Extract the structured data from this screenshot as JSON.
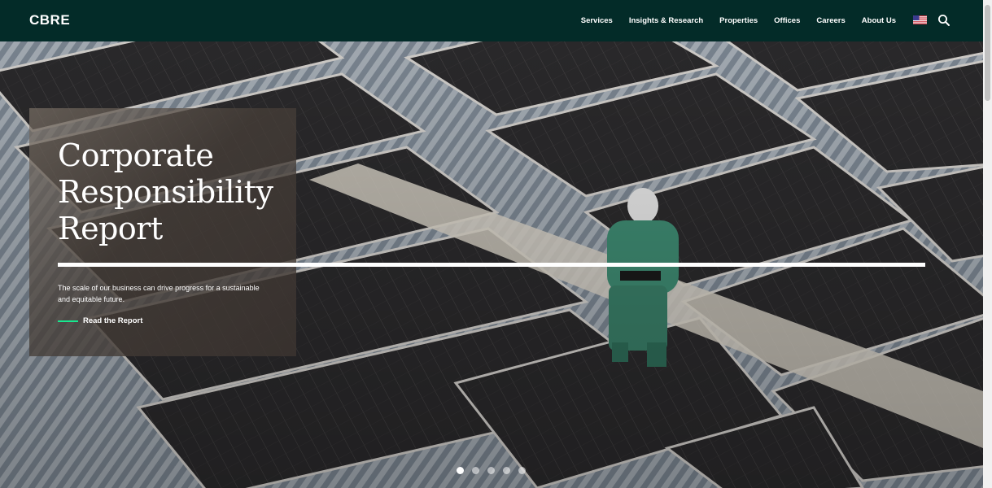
{
  "header": {
    "logo": "CBRE",
    "nav": [
      {
        "label": "Services"
      },
      {
        "label": "Insights & Research"
      },
      {
        "label": "Properties"
      },
      {
        "label": "Offices"
      },
      {
        "label": "Careers"
      },
      {
        "label": "About Us"
      }
    ],
    "locale_icon": "us-flag-icon",
    "search_icon": "search-icon"
  },
  "hero": {
    "title": "Corporate Responsibility Report",
    "description": "The scale of our business can drive progress for a sustainable and equitable future.",
    "cta_label": "Read the Report",
    "slide_count": 5,
    "active_slide": 1
  },
  "colors": {
    "header_bg": "#032b28",
    "accent": "#17e88f",
    "text": "#ffffff"
  }
}
